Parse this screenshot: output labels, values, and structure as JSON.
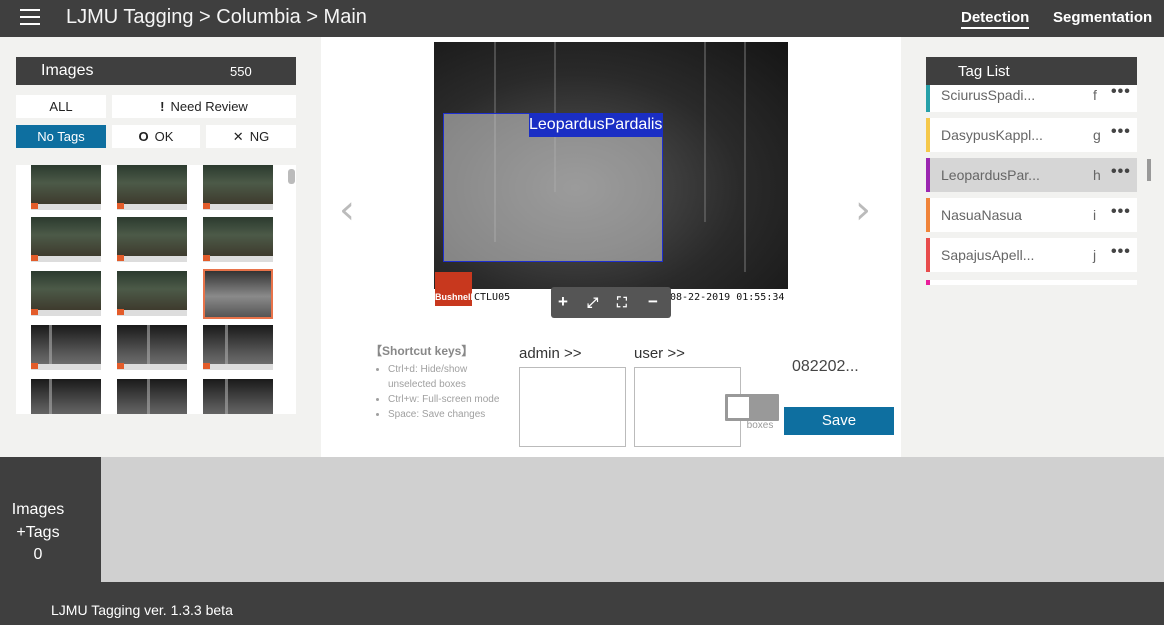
{
  "header": {
    "title": "LJMU Tagging > Columbia > Main",
    "nav": [
      "Detection",
      "Segmentation"
    ]
  },
  "images_panel": {
    "title": "Images",
    "count": "550",
    "filters": {
      "all": "ALL",
      "need_review": "Need Review",
      "no_tags": "No Tags",
      "ok": "OK",
      "ng": "NG"
    },
    "selected_filter": "No Tags"
  },
  "viewer": {
    "box_label": "LeopardusPardalis",
    "camera_id": "CTLU05",
    "timestamp": "08-22-2019   01:55:34",
    "camera_brand": "Bushnell",
    "shortcuts_title": "【Shortcut keys】",
    "shortcuts": [
      "Ctrl+d: Hide/show unselected boxes",
      "Ctrl+w: Full-screen mode",
      "Space: Save changes"
    ],
    "admin_label": "admin >>",
    "user_label": "user >>",
    "file_id": "082202...",
    "hide_boxes_label": "Hide boxes",
    "save_label": "Save"
  },
  "tag_panel": {
    "title": "Tag List",
    "tags": [
      {
        "name": "SciurusSpadi...",
        "key": "f",
        "color": "#27a0a8"
      },
      {
        "name": "DasypusKappl...",
        "key": "g",
        "color": "#f5c84a"
      },
      {
        "name": "LeopardusPar...",
        "key": "h",
        "color": "#9b27b0"
      },
      {
        "name": "NasuaNasua",
        "key": "i",
        "color": "#f0843a"
      },
      {
        "name": "SapajusApell...",
        "key": "j",
        "color": "#e84c4c"
      }
    ],
    "selected_tag": "LeopardusPar..."
  },
  "bottom": {
    "line1": "Images",
    "line2": "+Tags",
    "line3": "0"
  },
  "footer": {
    "version": "LJMU Tagging ver. 1.3.3 beta"
  }
}
